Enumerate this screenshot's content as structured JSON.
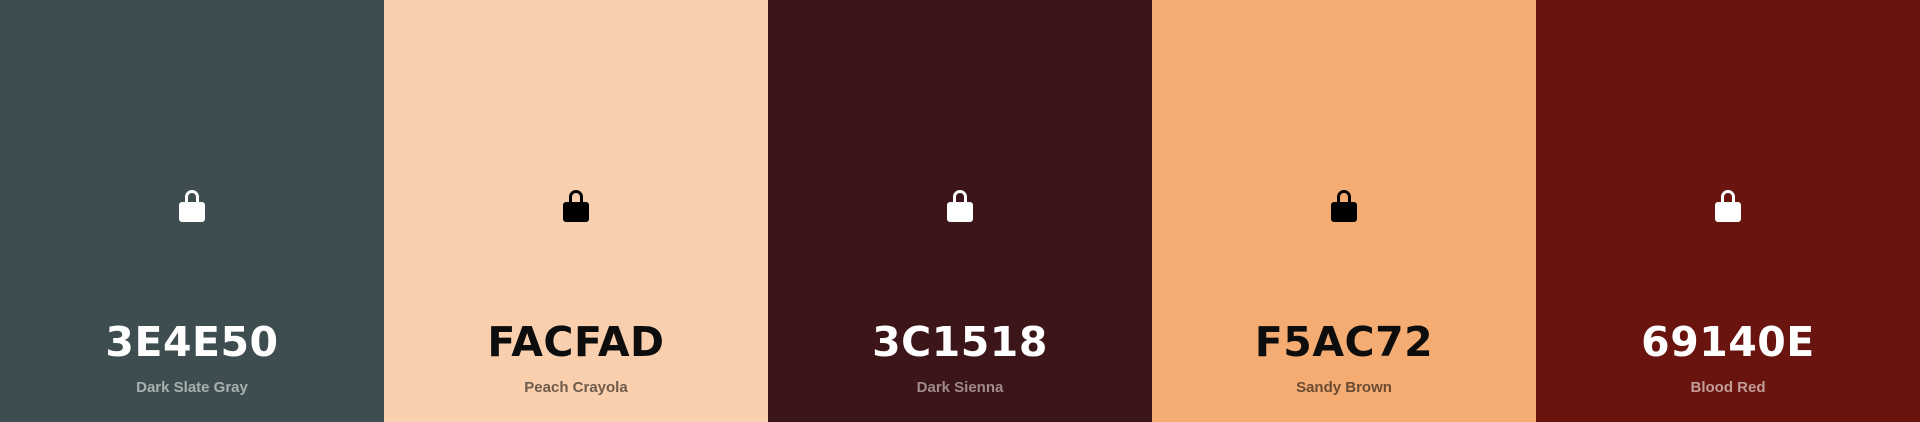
{
  "swatches": [
    {
      "hex": "3E4E50",
      "name": "Dark Slate Gray",
      "color": "#3E4E50",
      "icon": "lock-icon"
    },
    {
      "hex": "FACFAD",
      "name": "Peach Crayola",
      "color": "#FACFAD",
      "icon": "lock-icon"
    },
    {
      "hex": "3C1518",
      "name": "Dark Sienna",
      "color": "#3C1518",
      "icon": "lock-icon"
    },
    {
      "hex": "F5AC72",
      "name": "Sandy Brown",
      "color": "#F5AC72",
      "icon": "lock-icon"
    },
    {
      "hex": "69140E",
      "name": "Blood Red",
      "color": "#69140E",
      "icon": "lock-icon"
    }
  ]
}
